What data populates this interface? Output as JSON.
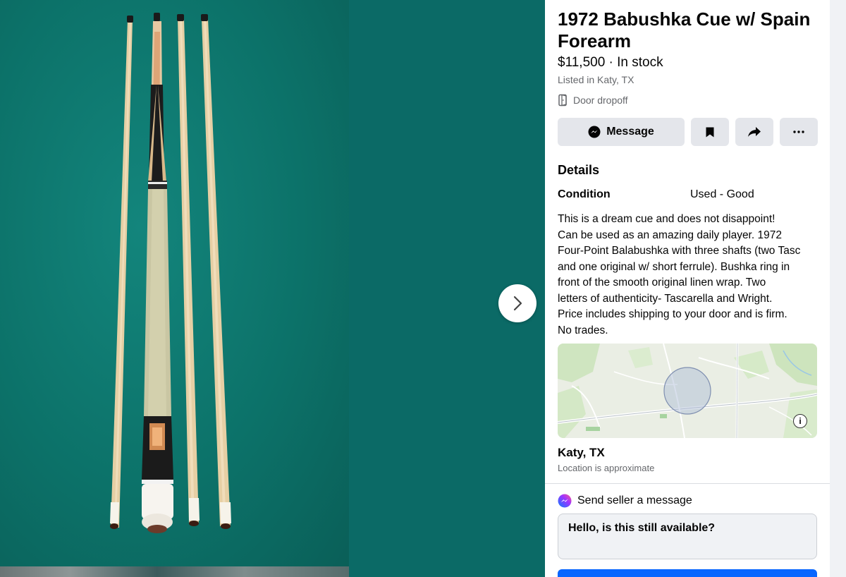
{
  "listing": {
    "title": "1972 Babushka Cue w/ Spain Forearm",
    "price_line": "$11,500 · In stock",
    "listed_in": "Listed in Katy, TX",
    "delivery": "Door dropoff"
  },
  "actions": {
    "message_label": "Message",
    "save_icon": "bookmark-icon",
    "share_icon": "share-icon",
    "more_icon": "more-icon"
  },
  "details": {
    "heading": "Details",
    "condition_label": "Condition",
    "condition_value": "Used - Good",
    "description": "This is a dream cue and does not disappoint!\nCan be used as an amazing daily player.  1972\nFour-Point Balabushka with three shafts (two Tasc\nand one original w/ short ferrule).  Bushka ring in\nfront of the smooth original linen wrap.  Two\nletters of authenticity- Tascarella and Wright.\nPrice includes shipping to your door and is firm.\nNo trades."
  },
  "location": {
    "name": "Katy, TX",
    "note": "Location is approximate",
    "info_icon_text": "i"
  },
  "seller_message": {
    "heading": "Send seller a message",
    "draft_text": "Hello, is this still available?"
  },
  "colors": {
    "accent": "#0866ff",
    "felt": "#0c7269",
    "button_bg": "#e4e6eb",
    "muted_text": "#65676b"
  }
}
